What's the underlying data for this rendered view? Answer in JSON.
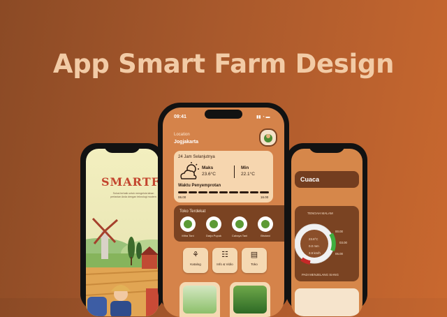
{
  "headline": "App Smart Farm Design",
  "left": {
    "logo": "SMARTFAR",
    "desc": "Solusi terbaik untuk mengelola lahan pertanian Anda dengan teknologi modern"
  },
  "center": {
    "time": "09:41",
    "location_label": "Location",
    "location_city": "Jogjakarta",
    "forecast": {
      "title": "24 Jam Selanjutnya",
      "max_label": "Maks",
      "max_value": "23.6°C",
      "min_label": "Min",
      "min_value": "22.1°C"
    },
    "spray": {
      "title": "Waktu Penyemprotan",
      "start": "06.00",
      "end": "16.00",
      "segments": 9
    },
    "stores": {
      "title": "Toko Terdekat",
      "items": [
        {
          "name": "Mitra Tani"
        },
        {
          "name": "Darja Pupuk"
        },
        {
          "name": "Cahaya Tani"
        },
        {
          "name": "Bhutani"
        }
      ]
    },
    "menu": [
      {
        "label": "Katalog",
        "icon": "sprout-icon"
      },
      {
        "label": "Info & Vidio",
        "icon": "document-icon"
      },
      {
        "label": "Toko",
        "icon": "store-icon"
      }
    ]
  },
  "right": {
    "title": "Cuaca",
    "period": "TENGAH MALAM",
    "temp": "23.6°C",
    "rain": "0.0 mm",
    "wind": "3.9 km/h",
    "times": [
      "00.00",
      "03.00",
      "06.00"
    ],
    "status": "PADI MENJELANG SIANG"
  },
  "colors": {
    "bg_start": "#8b4a25",
    "bg_end": "#c9682f",
    "headline": "#f2cba6",
    "screen": "#d5834a",
    "card_dark": "#6e3c20",
    "card_light": "#f5d9b3"
  }
}
